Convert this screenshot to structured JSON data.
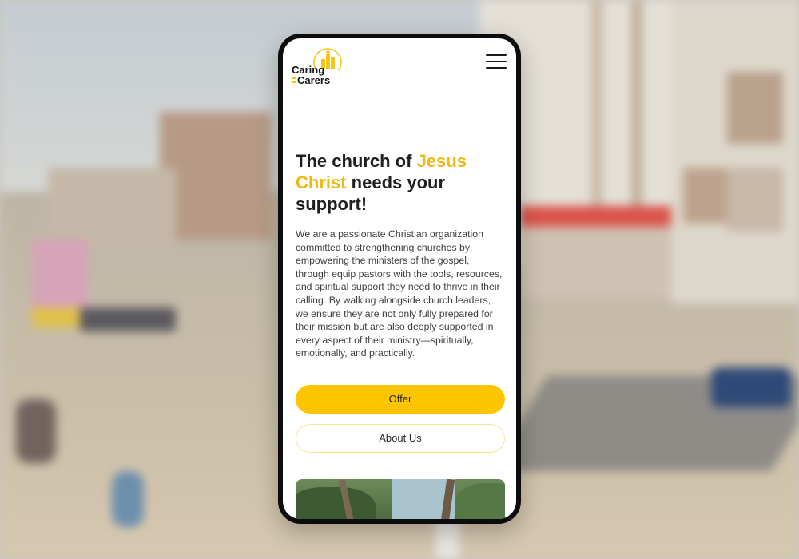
{
  "logo": {
    "line1": "Caring",
    "line2": "Carers"
  },
  "header": {
    "menu_icon": "hamburger-menu-icon"
  },
  "hero": {
    "title_part1": "The church of ",
    "title_accent": "Jesus Christ",
    "title_part2": " needs your support!",
    "description": "We are a passionate Christian organization committed to strengthening churches by empowering the ministers of the gospel, through equip pastors with the tools, resources, and spiritual support they need to thrive in their calling. By walking alongside church leaders, we ensure they are not only fully prepared for their mission but are also deeply supported in every aspect of their ministry—spiritually, emotionally, and practically."
  },
  "buttons": {
    "offer": "Offer",
    "about": "About Us"
  },
  "colors": {
    "accent": "#f1b90f",
    "button_primary": "#fdc500",
    "button_outline": "#fbe39a",
    "text_dark": "#1f1f1f"
  }
}
